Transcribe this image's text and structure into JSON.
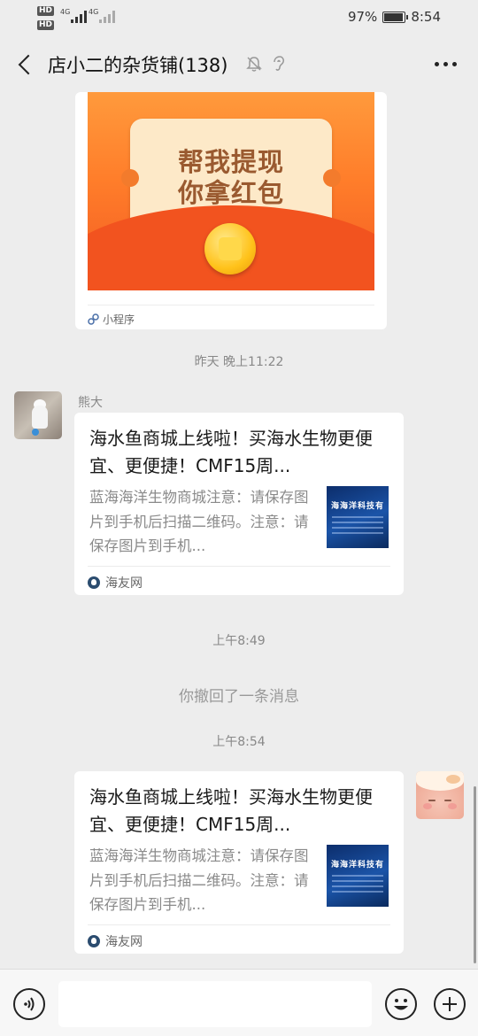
{
  "status_bar": {
    "network_label_1": "HD",
    "network_label_2": "HD",
    "signal_1_label": "4G",
    "signal_2_label": "4G",
    "battery_percent": "97%",
    "battery_level": 0.97,
    "time": "8:54"
  },
  "header": {
    "title": "店小二的杂货铺(138)",
    "icons": [
      "back-icon",
      "mute-icon",
      "ear-icon",
      "more-icon"
    ]
  },
  "messages": {
    "mini_program": {
      "image_text_line1": "帮我提现",
      "image_text_line2": "你拿红包",
      "footer_label": "小程序"
    },
    "timestamp_1": "昨天 晚上11:22",
    "sender_name": "熊大",
    "link_card_1": {
      "title": "海水鱼商城上线啦！买海水生物更便宜、更便捷！CMF15周...",
      "description": "蓝海海洋生物商城注意：请保存图片到手机后扫描二维码。注意：请保存图片到手机...",
      "thumb_text": "海海洋科技有",
      "source": "海友网"
    },
    "timestamp_2": "上午8:49",
    "recall_notice": "你撤回了一条消息",
    "timestamp_3": "上午8:54",
    "link_card_2": {
      "title": "海水鱼商城上线啦！买海水生物更便宜、更便捷！CMF15周...",
      "description": "蓝海海洋生物商城注意：请保存图片到手机后扫描二维码。注意：请保存图片到手机...",
      "thumb_text": "海海洋科技有",
      "source": "海友网"
    }
  },
  "input_bar": {
    "value": "",
    "icons": [
      "voice-icon",
      "emoji-icon",
      "plus-icon"
    ]
  },
  "colors": {
    "chat_background": "#ededed",
    "bubble_background": "#ffffff",
    "muted_text": "#888888"
  }
}
